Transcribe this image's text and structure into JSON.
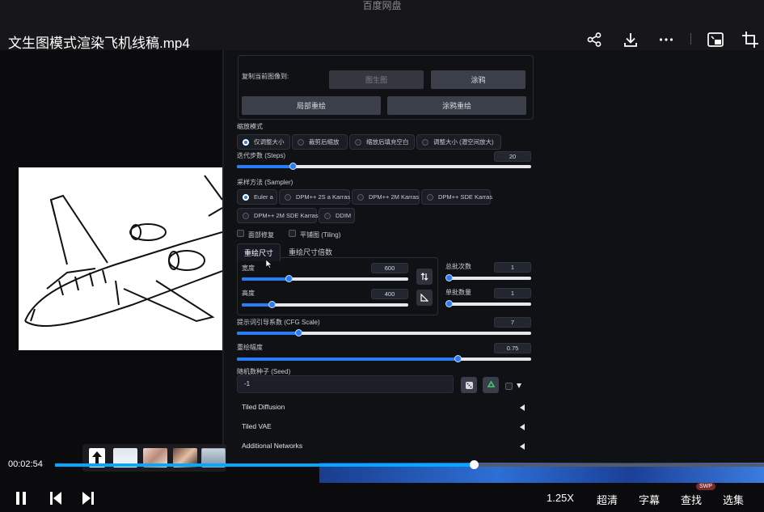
{
  "app": {
    "title": "百度网盘"
  },
  "header": {
    "file_title": "文生图模式渲染飞机线稿.mp4"
  },
  "header_icons": [
    "share-icon",
    "download-icon",
    "more-icon",
    "picture-in-picture-icon",
    "crop-icon"
  ],
  "webui": {
    "copy_image_label": "复制当前图像到:",
    "btn_img2img": "图生图",
    "btn_inpaint": "涂鸦",
    "btn_local_redraw": "局部重绘",
    "btn_inpaint_redraw": "涂鸦重绘",
    "resize_mode_label": "缩放模式",
    "resize_modes": [
      "仅调整大小",
      "裁剪后缩放",
      "缩放后填充空白",
      "调整大小 (潜空间放大)"
    ],
    "steps_label": "迭代步数 (Steps)",
    "steps_value": "20",
    "steps_fraction": 0.19,
    "sampler_label": "采样方法 (Sampler)",
    "samplers_row1": [
      "Euler a",
      "DPM++ 2S a Karras",
      "DPM++ 2M Karras",
      "DPM++ SDE Karras"
    ],
    "samplers_row2": [
      "DPM++ 2M SDE Karras",
      "DDIM"
    ],
    "face_restore_label": "面部修复",
    "tiling_label": "平铺图 (Tiling)",
    "tab_size": "重绘尺寸",
    "tab_scale": "重绘尺寸倍数",
    "width_label": "宽度",
    "width_value": "600",
    "width_fraction": 0.28,
    "height_label": "高度",
    "height_value": "400",
    "height_fraction": 0.18,
    "batch_count_label": "总批次数",
    "batch_count_value": "1",
    "batch_size_label": "单批数量",
    "batch_size_value": "1",
    "cfg_label": "提示词引导系数 (CFG Scale)",
    "cfg_value": "7",
    "cfg_fraction": 0.21,
    "denoise_label": "重绘幅度",
    "denoise_value": "0.75",
    "denoise_fraction": 0.75,
    "seed_label": "随机数种子 (Seed)",
    "seed_value": "-1",
    "accordions": [
      "Tiled Diffusion",
      "Tiled VAE",
      "Additional Networks"
    ]
  },
  "player": {
    "current_time": "00:02:54",
    "progress_fraction": 0.591,
    "speed": "1.25X",
    "quality": "超清",
    "subtitles": "字幕",
    "search": "查找",
    "search_badge": "SWP",
    "episodes": "选集"
  }
}
